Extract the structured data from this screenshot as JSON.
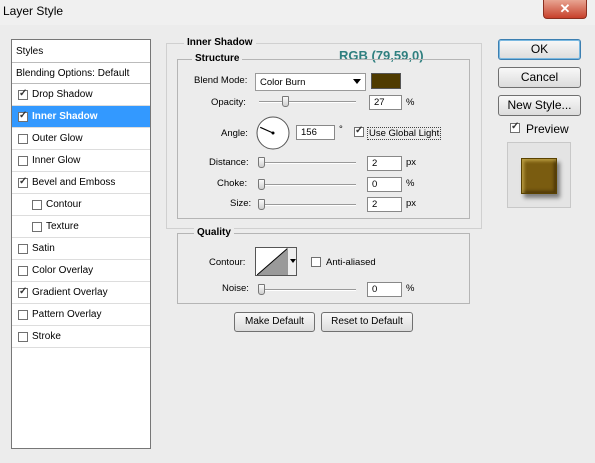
{
  "window": {
    "title": "Layer Style",
    "close_glyph": "✕"
  },
  "styles_panel": {
    "header": "Styles",
    "blending_options": "Blending Options: Default",
    "items": [
      {
        "label": "Drop Shadow",
        "checked": true,
        "selected": false,
        "sub": false
      },
      {
        "label": "Inner Shadow",
        "checked": true,
        "selected": true,
        "sub": false
      },
      {
        "label": "Outer Glow",
        "checked": false,
        "selected": false,
        "sub": false
      },
      {
        "label": "Inner Glow",
        "checked": false,
        "selected": false,
        "sub": false
      },
      {
        "label": "Bevel and Emboss",
        "checked": true,
        "selected": false,
        "sub": false
      },
      {
        "label": "Contour",
        "checked": false,
        "selected": false,
        "sub": true
      },
      {
        "label": "Texture",
        "checked": false,
        "selected": false,
        "sub": true
      },
      {
        "label": "Satin",
        "checked": false,
        "selected": false,
        "sub": false
      },
      {
        "label": "Color Overlay",
        "checked": false,
        "selected": false,
        "sub": false
      },
      {
        "label": "Gradient Overlay",
        "checked": true,
        "selected": false,
        "sub": false
      },
      {
        "label": "Pattern Overlay",
        "checked": false,
        "selected": false,
        "sub": false
      },
      {
        "label": "Stroke",
        "checked": false,
        "selected": false,
        "sub": false
      }
    ]
  },
  "inner_shadow": {
    "title": "Inner Shadow",
    "annotation": "RGB (79,59,0)",
    "structure": {
      "title": "Structure",
      "blend_mode_label": "Blend Mode:",
      "blend_mode_value": "Color Burn",
      "shadow_color": "#4f3b00",
      "opacity_label": "Opacity:",
      "opacity_value": "27",
      "opacity_unit": "%",
      "opacity_level": 0.27,
      "angle_label": "Angle:",
      "angle_value": "156",
      "angle_unit": "°",
      "angle_degrees": 156,
      "global_light_label": "Use Global Light",
      "global_light_checked": true,
      "distance_label": "Distance:",
      "distance_value": "2",
      "distance_unit": "px",
      "choke_label": "Choke:",
      "choke_value": "0",
      "choke_unit": "%",
      "size_label": "Size:",
      "size_value": "2",
      "size_unit": "px"
    },
    "quality": {
      "title": "Quality",
      "contour_label": "Contour:",
      "anti_aliased_label": "Anti-aliased",
      "anti_aliased_checked": false,
      "noise_label": "Noise:",
      "noise_value": "0",
      "noise_unit": "%"
    },
    "make_default": "Make Default",
    "reset_default": "Reset to Default"
  },
  "actions": {
    "ok": "OK",
    "cancel": "Cancel",
    "new_style": "New Style...",
    "preview_label": "Preview",
    "preview_checked": true,
    "preview_swatch": "#7a5c10"
  }
}
